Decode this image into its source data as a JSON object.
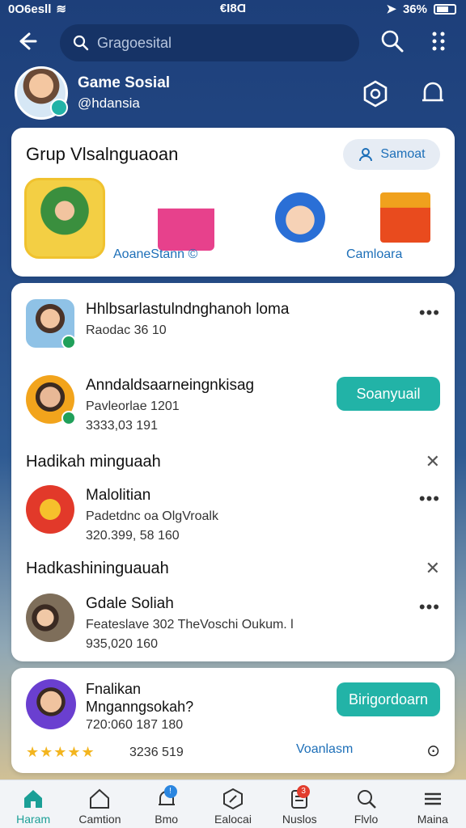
{
  "status": {
    "left": "0O6esll",
    "center": "€Ɩ8Ɑ",
    "right": "36%"
  },
  "search": {
    "placeholder": "Gragoesital"
  },
  "profile": {
    "name": "Game Sosial",
    "handle": "@hdansia"
  },
  "groups": {
    "title": "Grup Vlsalnguaoan",
    "action_label": "Samoat",
    "labels": [
      "AoaneStann ©",
      "Camloara"
    ]
  },
  "list": {
    "items": [
      {
        "title": "Hhlbsarlastulndnghanoh loma",
        "sub1": "Raodac  36      10"
      },
      {
        "title": "Anndaldsaarneingnkisag",
        "sub1": "Pavleorlae  1201",
        "sub2": "3333,03      191",
        "button": "Soanyuail"
      },
      {
        "title": "Malolitian",
        "sub1": "Padetdnc oa     OlgVroalk",
        "sub2": "320.399, 58      160"
      },
      {
        "title": "Gdale Soliah",
        "sub1": "Feateslave 302     TheVoschi Oukum.       l",
        "sub2": "935,020      160"
      }
    ],
    "section1": "Hadikah minguaah",
    "section2": "Hadkashininguauah"
  },
  "bottom_card": {
    "title_line1": "Fnalikan",
    "title_line2": "Mnganngsokah?",
    "meta": "720:060  187      180",
    "stars": "★★★★★",
    "score": "3236 519",
    "link": "Voanlasm",
    "button": "Birigordoarn"
  },
  "tabs": [
    {
      "label": "Haram",
      "icon": "home-icon"
    },
    {
      "label": "Camtion",
      "icon": "house-outline-icon"
    },
    {
      "label": "Bmo",
      "icon": "bell-icon",
      "badge": "!"
    },
    {
      "label": "Ealocai",
      "icon": "map-icon"
    },
    {
      "label": "Nuslos",
      "icon": "notes-icon",
      "badge": "3"
    },
    {
      "label": "Flvlo",
      "icon": "search-icon"
    },
    {
      "label": "Maina",
      "icon": "menu-icon"
    }
  ],
  "colors": {
    "accent": "#22b3a7",
    "link": "#1d6fb8",
    "header": "#1d3f7a"
  }
}
